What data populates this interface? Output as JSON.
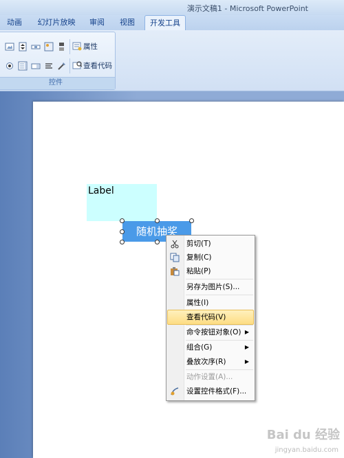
{
  "window": {
    "title": "演示文稿1 - Microsoft PowerPoint"
  },
  "tabs": [
    {
      "label": "动画"
    },
    {
      "label": "幻灯片放映"
    },
    {
      "label": "审阅"
    },
    {
      "label": "视图"
    },
    {
      "label": "开发工具",
      "active": true
    }
  ],
  "ribbon": {
    "group_label": "控件",
    "properties_label": "属性",
    "view_code_label": "查看代码"
  },
  "slide": {
    "label_text": "Label",
    "button_text": "随机抽奖"
  },
  "context_menu": {
    "items": [
      {
        "label": "剪切(T)",
        "icon": "scissors-icon"
      },
      {
        "label": "复制(C)",
        "icon": "copy-icon"
      },
      {
        "label": "粘贴(P)",
        "icon": "paste-icon"
      },
      {
        "label": "另存为图片(S)...",
        "icon": ""
      },
      {
        "label": "属性(I)",
        "icon": ""
      },
      {
        "label": "查看代码(V)",
        "icon": "",
        "highlighted": true
      },
      {
        "label": "命令按钮对象(O)",
        "icon": "",
        "submenu": true
      },
      {
        "label": "组合(G)",
        "icon": "",
        "submenu": true
      },
      {
        "label": "叠放次序(R)",
        "icon": "",
        "submenu": true
      },
      {
        "label": "动作设置(A)...",
        "icon": "",
        "disabled": true
      },
      {
        "label": "设置控件格式(F)...",
        "icon": "format-control-icon"
      }
    ],
    "submenu_arrow": "▶"
  },
  "watermark": {
    "brand": "Bai du 经验",
    "url": "jingyan.baidu.com"
  }
}
